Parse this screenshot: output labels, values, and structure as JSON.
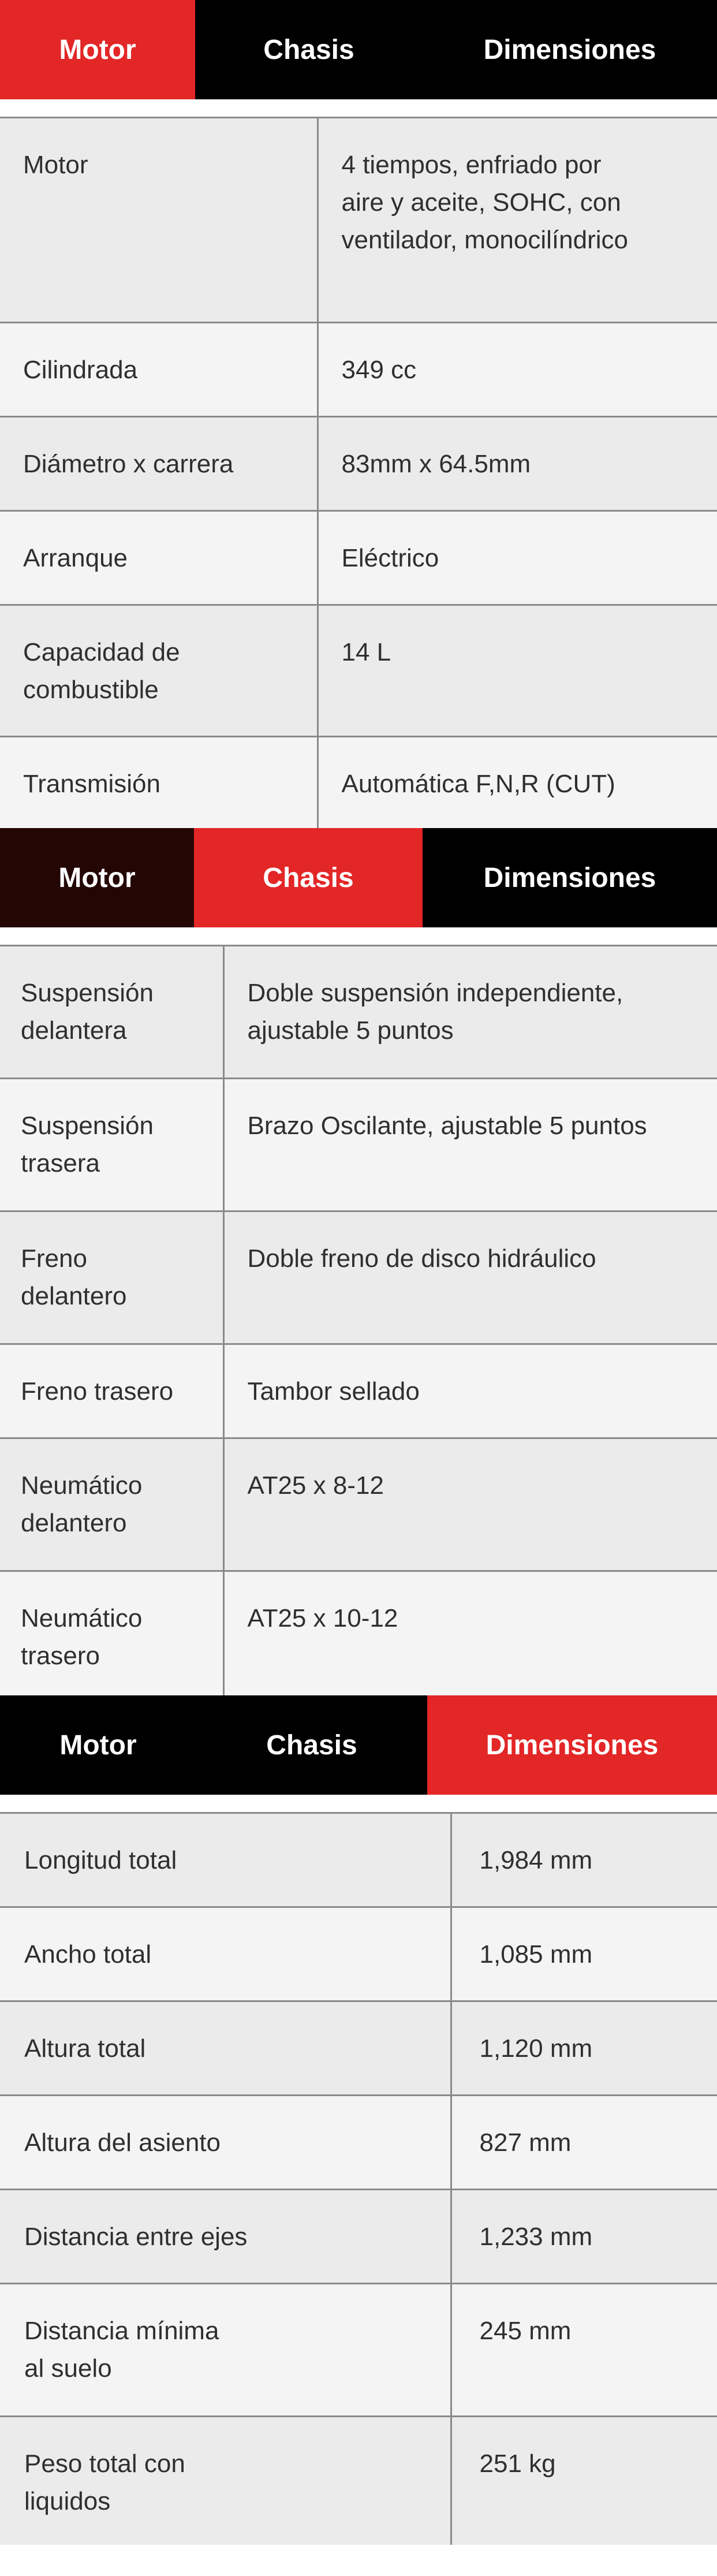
{
  "colors": {
    "accent": "#e32626",
    "tab_bg": "#000000",
    "row_odd": "#ebebeb",
    "row_even": "#f4f4f4",
    "divider": "#8a8a8a"
  },
  "sections": [
    {
      "tabs": [
        "Motor",
        "Chasis",
        "Dimensiones"
      ],
      "active": 0,
      "rows": [
        {
          "label": "Motor",
          "value": "4 tiempos, enfriado por aire y aceite, SOHC, con ventilador, monocilíndrico"
        },
        {
          "label": "Cilindrada",
          "value": "349 cc"
        },
        {
          "label": "Diámetro x carrera",
          "value": "83mm x 64.5mm"
        },
        {
          "label": "Arranque",
          "value": "Eléctrico"
        },
        {
          "label": "Capacidad de combustible",
          "value": "14 L"
        },
        {
          "label": "Transmisión",
          "value": "Automática F,N,R (CUT)"
        }
      ]
    },
    {
      "tabs": [
        "Motor",
        "Chasis",
        "Dimensiones"
      ],
      "active": 1,
      "rows": [
        {
          "label": "Suspensión delantera",
          "value": "Doble suspensión independiente, ajustable 5 puntos"
        },
        {
          "label": "Suspensión trasera",
          "value": "Brazo Oscilante, ajustable 5 puntos"
        },
        {
          "label": "Freno delantero",
          "value": "Doble freno de disco hidráulico"
        },
        {
          "label": "Freno trasero",
          "value": "Tambor sellado"
        },
        {
          "label": "Neumático delantero",
          "value": "AT25 x 8-12"
        },
        {
          "label": "Neumático trasero",
          "value": "AT25 x 10-12"
        }
      ]
    },
    {
      "tabs": [
        "Motor",
        "Chasis",
        "Dimensiones"
      ],
      "active": 2,
      "rows": [
        {
          "label": "Longitud total",
          "value": "1,984 mm"
        },
        {
          "label": "Ancho total",
          "value": "1,085 mm"
        },
        {
          "label": "Altura total",
          "value": "1,120 mm"
        },
        {
          "label": "Altura del asiento",
          "value": "827 mm"
        },
        {
          "label": "Distancia entre ejes",
          "value": "1,233 mm"
        },
        {
          "label": "Distancia mínima al suelo",
          "value": "245 mm"
        },
        {
          "label": "Peso total con liquidos",
          "value": "251 kg"
        }
      ]
    }
  ]
}
